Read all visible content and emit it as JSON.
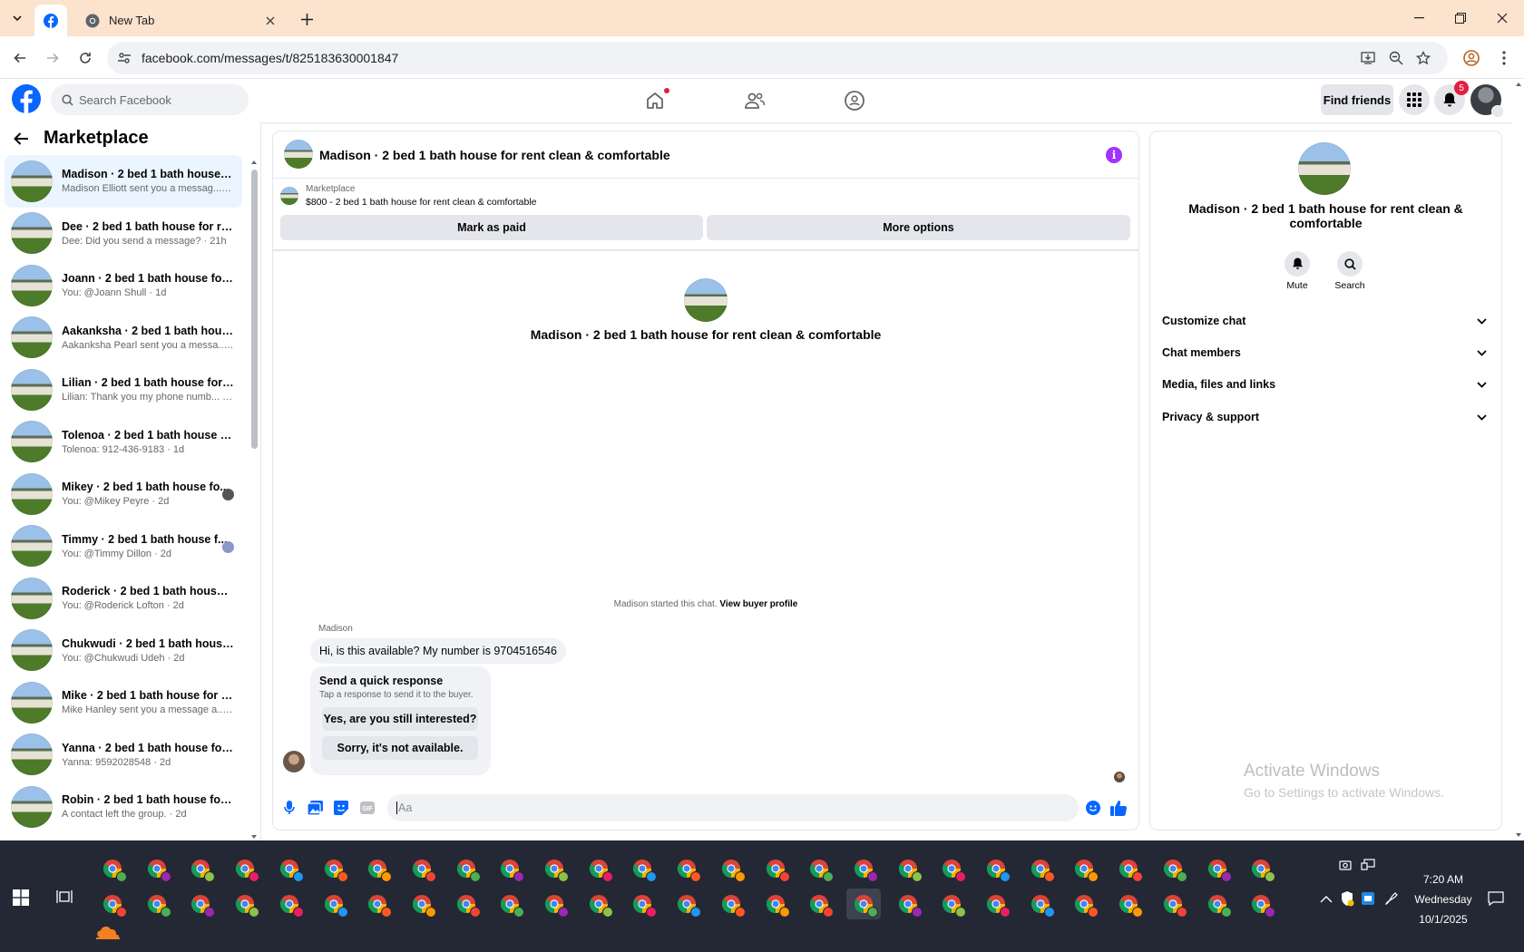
{
  "browser": {
    "tabs": [
      {
        "label": "",
        "icon": "facebook-icon"
      },
      {
        "label": "New Tab",
        "icon": "chrome-icon"
      }
    ],
    "url": "facebook.com/messages/t/825183630001847"
  },
  "fb_header": {
    "search_placeholder": "Search Facebook",
    "find_friends": "Find friends",
    "notif_count": "5"
  },
  "sidebar": {
    "title": "Marketplace",
    "conversations": [
      {
        "name": "Madison · 2 bed 1 bath house f...",
        "preview": "Madison Elliott sent you a messag... · 3h",
        "selected": true
      },
      {
        "name": "Dee · 2 bed 1 bath house for re...",
        "preview": "Dee: Did you send a message? · 21h"
      },
      {
        "name": "Joann · 2 bed 1 bath house for r...",
        "preview": "You: @Joann Shull · 1d"
      },
      {
        "name": "Aakanksha · 2 bed 1 bath house...",
        "preview": "Aakanksha Pearl sent you a messa... · 1d"
      },
      {
        "name": "Lilian · 2 bed 1 bath house for r...",
        "preview": "Lilian: Thank you my phone numb... · 1d"
      },
      {
        "name": "Tolenoa · 2 bed 1 bath house fo...",
        "preview": "Tolenoa: 912-436-9183 · 1d"
      },
      {
        "name": "Mikey · 2 bed 1 bath house fo...",
        "preview": "You: @Mikey Peyre · 2d"
      },
      {
        "name": "Timmy · 2 bed 1 bath house f...",
        "preview": "You: @Timmy Dillon · 2d"
      },
      {
        "name": "Roderick · 2 bed 1 bath house f...",
        "preview": "You: @Roderick Lofton · 2d"
      },
      {
        "name": "Chukwudi · 2 bed 1 bath house ...",
        "preview": "You: @Chukwudi Udeh · 2d"
      },
      {
        "name": "Mike · 2 bed 1 bath house for re...",
        "preview": "Mike Hanley sent you a message a... · 2d"
      },
      {
        "name": "Yanna · 2 bed 1 bath house for r...",
        "preview": "Yanna: 9592028548 · 2d"
      },
      {
        "name": "Robin · 2 bed 1 bath house for r...",
        "preview": "A contact left the group. · 2d"
      }
    ]
  },
  "chat": {
    "title": "Madison · 2 bed 1 bath house for rent clean & comfortable",
    "listing_source": "Marketplace",
    "listing_line": "$800 - 2 bed 1 bath house for rent clean & comfortable",
    "mark_paid": "Mark as paid",
    "more_options": "More options",
    "started_text": "Madison started this chat.",
    "view_profile": "View buyer profile",
    "sender": "Madison",
    "message": "Hi, is this available? My number is 9704516546",
    "quick_title": "Send a quick response",
    "quick_sub": "Tap a response to send it to the buyer.",
    "quick_1": "Yes, are you still interested?",
    "quick_2": "Sorry, it's not available.",
    "composer_placeholder": "Aa"
  },
  "details": {
    "title": "Madison · 2 bed 1 bath house for rent clean & comfortable",
    "mute": "Mute",
    "search": "Search",
    "sections": [
      "Customize chat",
      "Chat members",
      "Media, files and links",
      "Privacy & support"
    ]
  },
  "watermark": {
    "line1": "Activate Windows",
    "line2": "Go to Settings to activate Windows."
  },
  "taskbar": {
    "time": "7:20 AM",
    "day": "Wednesday",
    "date": "10/1/2025"
  },
  "colors": {
    "facebook_blue": "#0866ff",
    "taskbar": "#232834",
    "accent_purple": "#a033ff"
  }
}
